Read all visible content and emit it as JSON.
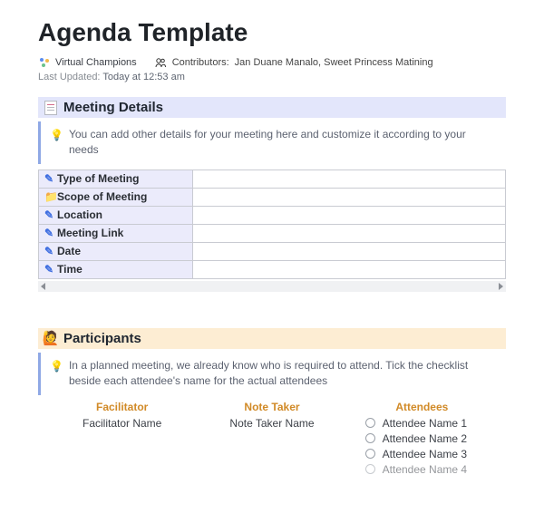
{
  "title": "Agenda Template",
  "meta": {
    "team_name": "Virtual Champions",
    "contributors_label": "Contributors:",
    "contributors_names": "Jan Duane Manalo, Sweet Princess Matining",
    "updated_label": "Last Updated:",
    "updated_value": "Today at 12:53 am"
  },
  "details": {
    "heading": "Meeting Details",
    "callout": "You can add other details for your meeting here and customize it according to your needs",
    "rows": [
      {
        "icon": "pen",
        "label": "Type of Meeting",
        "value": ""
      },
      {
        "icon": "folder",
        "label": "Scope of Meeting",
        "value": ""
      },
      {
        "icon": "pen",
        "label": "Location",
        "value": ""
      },
      {
        "icon": "pen",
        "label": "Meeting Link",
        "value": ""
      },
      {
        "icon": "pen",
        "label": "Date",
        "value": ""
      },
      {
        "icon": "pen",
        "label": "Time",
        "value": ""
      }
    ]
  },
  "participants": {
    "heading": "Participants",
    "callout": "In a planned meeting, we already know who is required to attend. Tick the checklist beside each attendee's name for the actual attendees",
    "facilitator_header": "Facilitator",
    "facilitator_value": "Facilitator Name",
    "notetaker_header": "Note Taker",
    "notetaker_value": "Note Taker Name",
    "attendees_header": "Attendees",
    "attendees": [
      "Attendee Name 1",
      "Attendee Name 2",
      "Attendee Name 3",
      "Attendee Name 4"
    ]
  }
}
